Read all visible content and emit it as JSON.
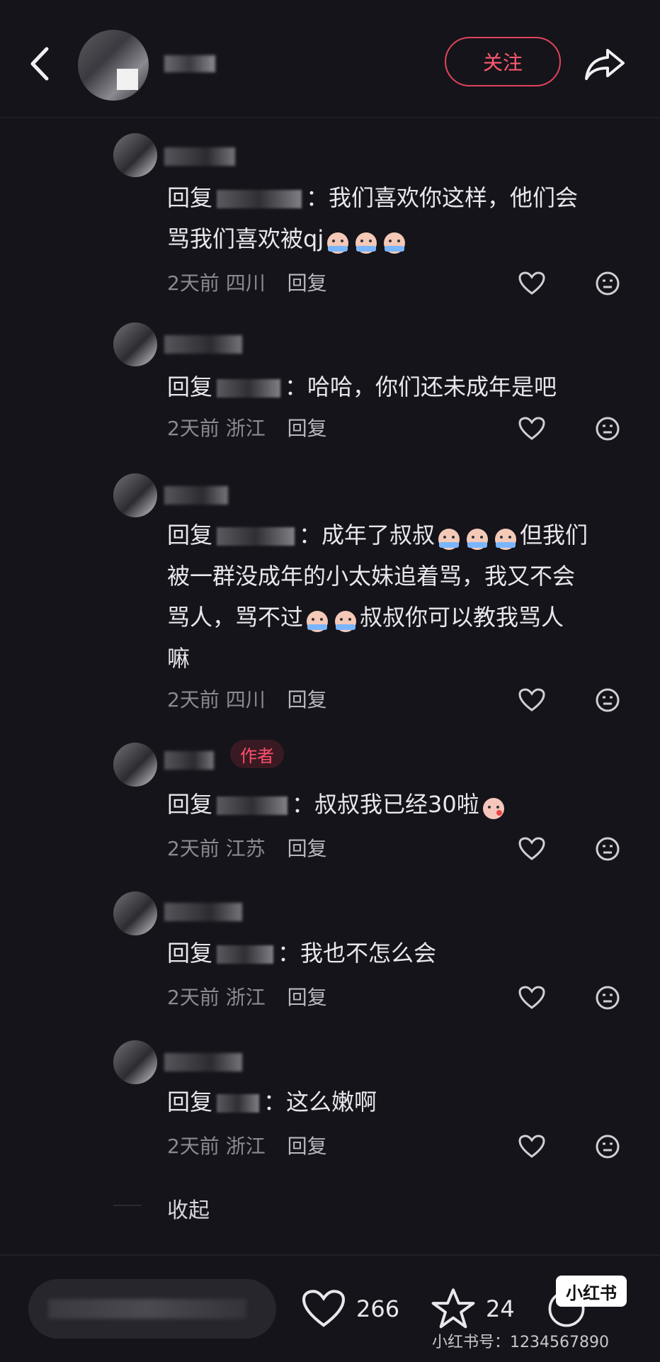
{
  "header": {
    "follow_label": "关注",
    "back_icon": "chevron-left-icon",
    "share_icon": "share-arrow-icon"
  },
  "comments": [
    {
      "reply_prefix": "回复",
      "text_lines": [
        "我们喜欢你这样，他们会",
        "骂我们喜欢被qj"
      ],
      "time": "2天前",
      "location": "四川",
      "reply_label": "回复",
      "is_author": false,
      "emoji_count": 3
    },
    {
      "reply_prefix": "回复",
      "text_lines": [
        "哈哈，你们还未成年是吧"
      ],
      "time": "2天前",
      "location": "浙江",
      "reply_label": "回复",
      "is_author": false
    },
    {
      "reply_prefix": "回复",
      "text_lines": [
        "成年了叔叔",
        "但我们",
        "被一群没成年的小太妹追着骂，我又不会",
        "骂人，骂不过",
        "叔叔你可以教我骂人",
        "嘛"
      ],
      "time": "2天前",
      "location": "四川",
      "reply_label": "回复",
      "is_author": false
    },
    {
      "reply_prefix": "回复",
      "text_lines": [
        "叔叔我已经30啦"
      ],
      "time": "2天前",
      "location": "江苏",
      "reply_label": "回复",
      "is_author": true,
      "author_tag": "作者"
    },
    {
      "reply_prefix": "回复",
      "text_lines": [
        "我也不怎么会"
      ],
      "time": "2天前",
      "location": "浙江",
      "reply_label": "回复",
      "is_author": false
    },
    {
      "reply_prefix": "回复",
      "text_lines": [
        "这么嫩啊"
      ],
      "time": "2天前",
      "location": "浙江",
      "reply_label": "回复",
      "is_author": false
    }
  ],
  "collapse_label": "收起",
  "bottom_bar": {
    "like_count": "266",
    "star_count": "24",
    "logo_text": "小红书",
    "watermark": "小红书号：1234567890"
  },
  "colors": {
    "background": "#15141a",
    "accent": "#e0445c",
    "author_tag_text": "#ff5070"
  }
}
